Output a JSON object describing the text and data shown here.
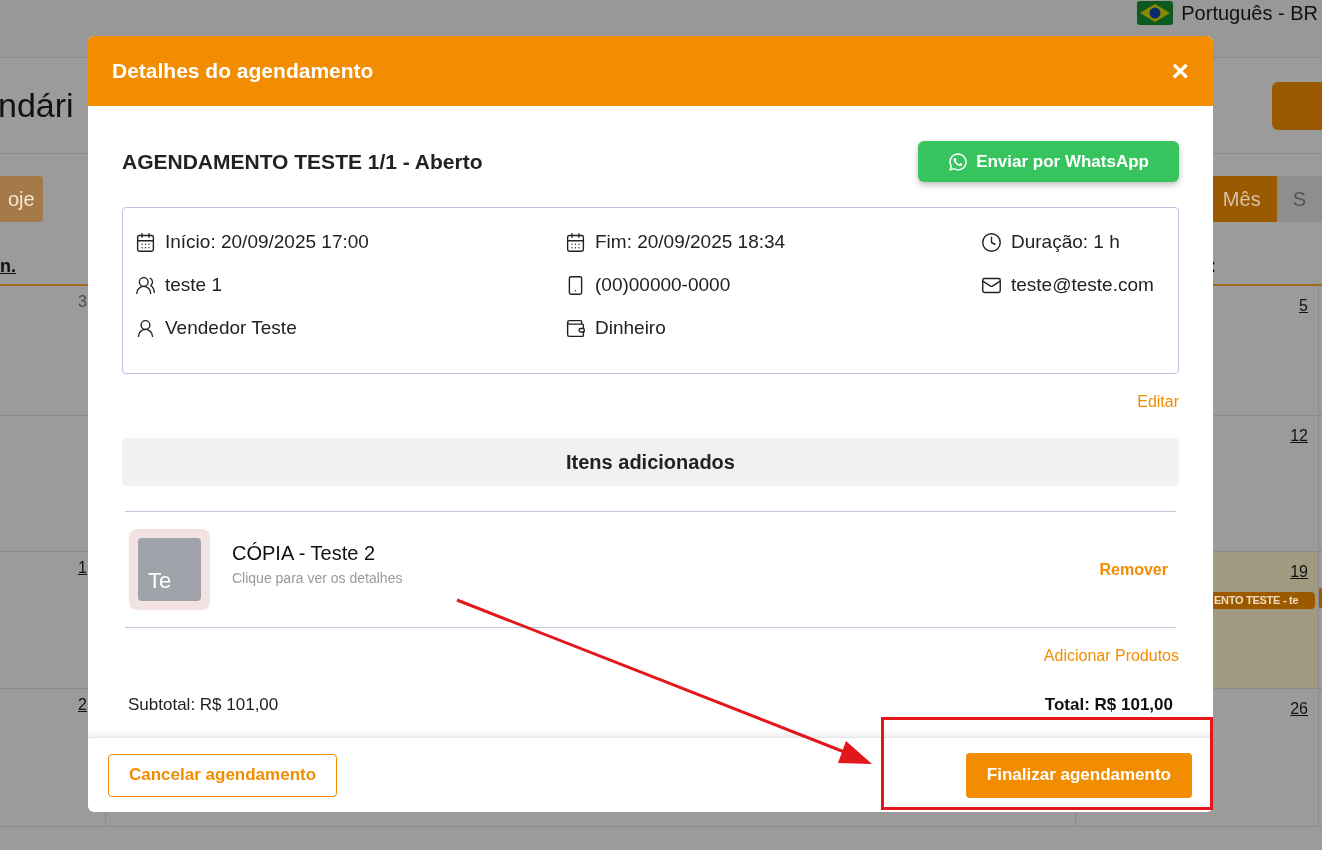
{
  "page": {
    "language": "Português - BR",
    "title": "ndári",
    "today_button": "oje",
    "view_buttons": [
      {
        "label": "Mês",
        "selected": true
      },
      {
        "label": "S",
        "selected": false
      }
    ],
    "weekday_headers": [
      "n.",
      ":"
    ],
    "weeks": [
      {
        "left": {
          "day": "3",
          "outside_month": true
        },
        "right": {
          "day": "5",
          "outside_month": false,
          "today": false
        }
      },
      {
        "right": {
          "day": "12",
          "outside_month": false,
          "today": false
        }
      },
      {
        "left": {
          "day": "1",
          "outside_month": false
        },
        "right": {
          "day": "19",
          "outside_month": false,
          "today": true,
          "events": [
            "ENTO TESTE - te"
          ]
        }
      },
      {
        "left": {
          "day": "2",
          "outside_month": false
        },
        "right": {
          "day": "26",
          "outside_month": false,
          "today": false
        }
      }
    ]
  },
  "modal": {
    "title": "Detalhes do agendamento",
    "close": "×",
    "heading": "AGENDAMENTO TESTE 1/1 - Aberto",
    "whatsapp_button": "Enviar por WhatsApp",
    "details": [
      {
        "kind": "calendar",
        "text": "Início: 20/09/2025 17:00"
      },
      {
        "kind": "calendar",
        "text": "Fim: 20/09/2025 18:34"
      },
      {
        "kind": "clock",
        "text": "Duração: 1 h"
      },
      {
        "kind": "client",
        "text": "teste 1"
      },
      {
        "kind": "phone",
        "text": "(00)00000-0000"
      },
      {
        "kind": "mail",
        "text": "teste@teste.com"
      },
      {
        "kind": "seller",
        "text": "Vendedor Teste"
      },
      {
        "kind": "wallet",
        "text": "Dinheiro"
      }
    ],
    "edit_link": "Editar",
    "items_title": "Itens adicionados",
    "items": [
      {
        "thumb": "Te",
        "name": "CÓPIA - Teste 2",
        "hint": "Clique para ver os detalhes",
        "remove": "Remover"
      }
    ],
    "add_products": "Adicionar Produtos",
    "subtotal": "Subtotal: R$ 101,00",
    "total": "Total: R$ 101,00",
    "cancel_button": "Cancelar agendamento",
    "finish_button": "Finalizar agendamento"
  }
}
